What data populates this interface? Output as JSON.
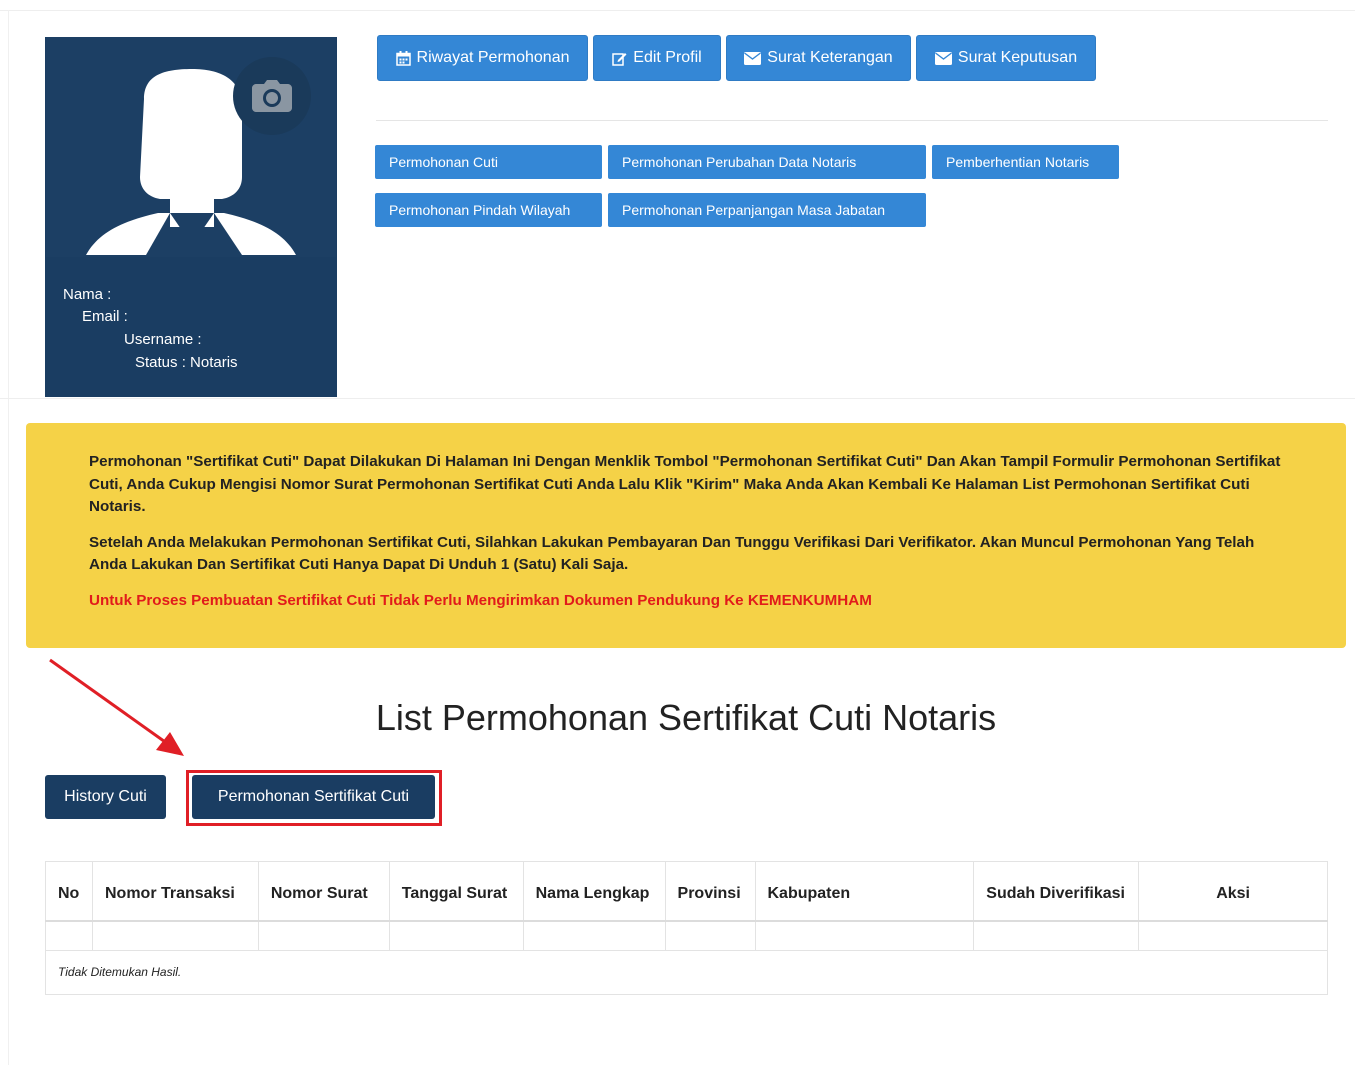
{
  "profile": {
    "nama_label": "Nama :",
    "email_label": "Email :",
    "username_label": "Username :",
    "status_label": "Status : Notaris"
  },
  "top_buttons": {
    "riwayat": "Riwayat Permohonan",
    "edit_profil": "Edit Profil",
    "surat_keterangan": "Surat Keterangan",
    "surat_keputusan": "Surat Keputusan"
  },
  "menu_buttons": {
    "cuti": "Permohonan Cuti",
    "perubahan_data": "Permohonan Perubahan Data Notaris",
    "pemberhentian": "Pemberhentian Notaris",
    "pindah_wilayah": "Permohonan Pindah Wilayah",
    "perpanjangan": "Permohonan Perpanjangan Masa Jabatan"
  },
  "alert": {
    "p1": "Permohonan \"Sertifikat Cuti\" Dapat Dilakukan Di Halaman Ini Dengan Menklik Tombol \"Permohonan Sertifikat Cuti\" Dan Akan Tampil Formulir Permohonan Sertifikat Cuti, Anda Cukup Mengisi Nomor Surat Permohonan Sertifikat Cuti Anda Lalu Klik \"Kirim\" Maka Anda Akan Kembali Ke Halaman List Permohonan Sertifikat Cuti Notaris.",
    "p2": "Setelah Anda Melakukan Permohonan Sertifikat Cuti, Silahkan Lakukan Pembayaran Dan Tunggu Verifikasi Dari Verifikator. Akan Muncul Permohonan Yang Telah Anda Lakukan Dan Sertifikat Cuti Hanya Dapat Di Unduh 1 (Satu) Kali Saja.",
    "p3": "Untuk Proses Pembuatan Sertifikat Cuti Tidak Perlu Mengirimkan Dokumen Pendukung Ke KEMENKUMHAM"
  },
  "list": {
    "title": "List Permohonan Sertifikat Cuti Notaris",
    "history_button": "History Cuti",
    "request_button": "Permohonan Sertifikat Cuti"
  },
  "table": {
    "headers": [
      "No",
      "Nomor Transaksi",
      "Nomor Surat",
      "Tanggal Surat",
      "Nama Lengkap",
      "Provinsi",
      "Kabupaten",
      "Sudah Diverifikasi",
      "Aksi"
    ],
    "empty_text": "Tidak Ditemukan Hasil."
  },
  "colors": {
    "navy": "#1a3d62",
    "blue": "#3487d6",
    "alert_yellow": "#f5d247",
    "alert_red": "#e11b1b",
    "highlight_red": "#e01f26"
  }
}
